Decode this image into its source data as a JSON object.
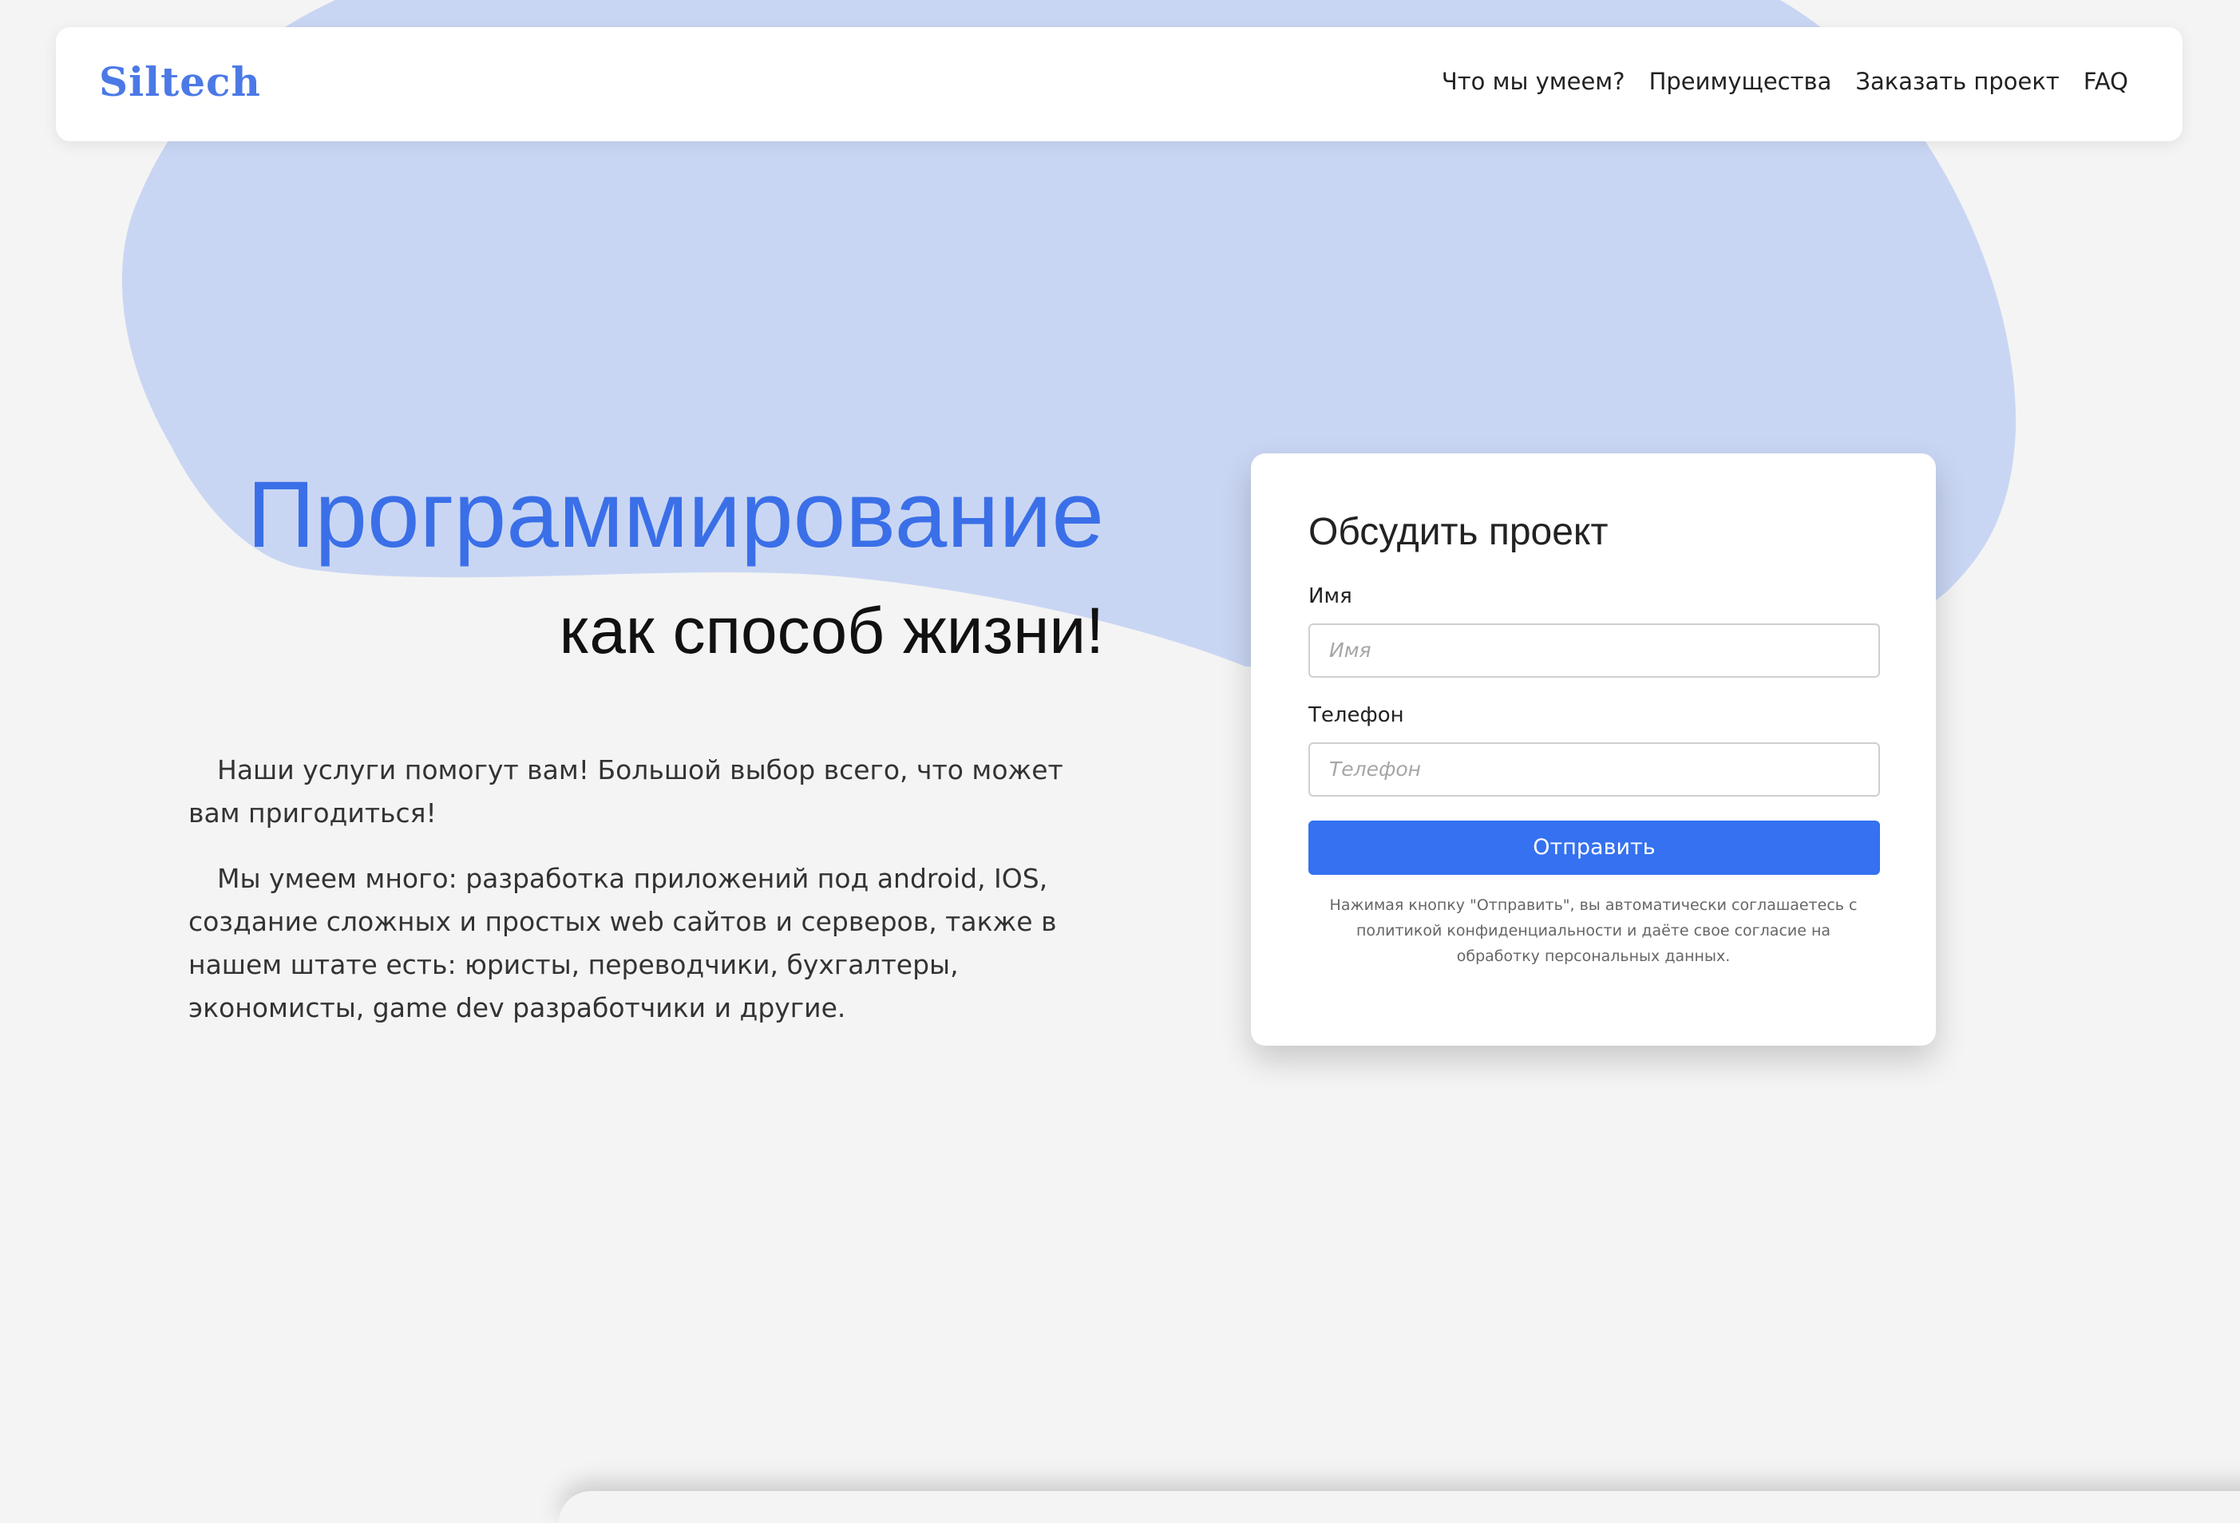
{
  "brand": {
    "name": "Siltech",
    "accent_color": "#4b79e6",
    "blob_color": "#c9d6f3",
    "button_color": "#3571f0"
  },
  "nav": {
    "items": [
      {
        "label": "Что мы умеем?"
      },
      {
        "label": "Преимущества"
      },
      {
        "label": "Заказать проект"
      },
      {
        "label": "FAQ"
      }
    ]
  },
  "hero": {
    "title": "Программирование",
    "subtitle": "как способ жизни!",
    "paragraphs": [
      "Наши услуги помогут вам! Большой выбор всего, что может вам пригодиться!",
      "Мы умеем много: разработка приложений под android, IOS, создание сложных и простых web сайтов и серверов, также в нашем штате есть: юристы, переводчики, бухгалтеры, экономисты, game dev разработчики и другие."
    ]
  },
  "form": {
    "title": "Обсудить проект",
    "name_label": "Имя",
    "name_placeholder": "Имя",
    "phone_label": "Телефон",
    "phone_placeholder": "Телефон",
    "submit_label": "Отправить",
    "note": "Нажимая кнопку \"Отправить\", вы автоматически соглашаетесь с политикой конфиденциальности и даёте свое согласие на обработку персональных данных."
  }
}
